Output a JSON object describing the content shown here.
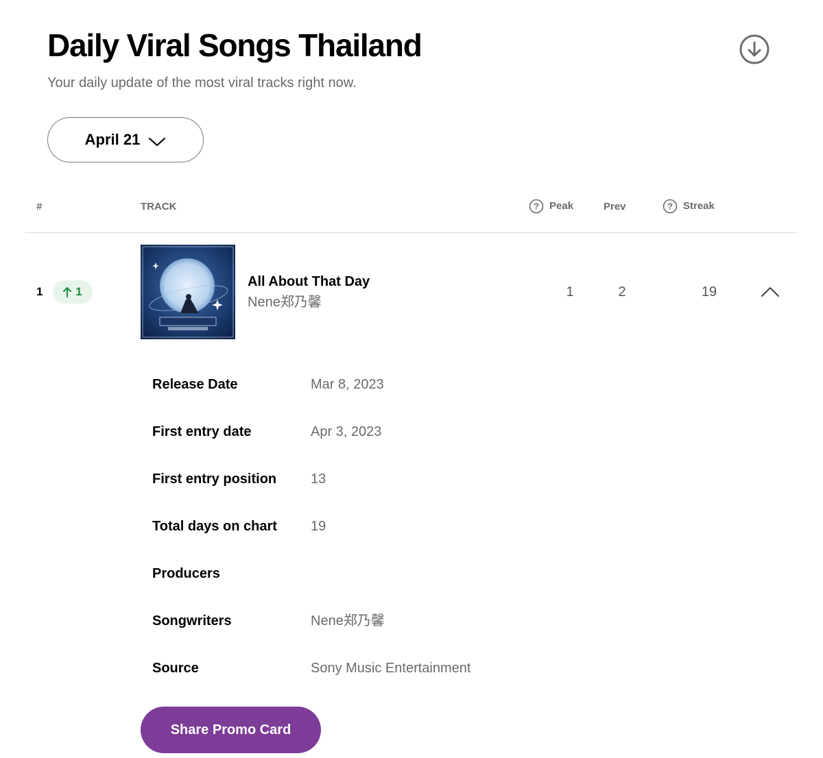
{
  "header": {
    "title": "Daily Viral Songs Thailand",
    "subtitle": "Your daily update of the most viral tracks right now.",
    "download_icon": "arrow-down-circle-icon"
  },
  "date_selector": {
    "label": "April 21",
    "icon": "chevron-down-icon"
  },
  "table": {
    "columns": {
      "rank": "#",
      "track": "TRACK",
      "peak": "Peak",
      "prev": "Prev",
      "streak": "Streak"
    },
    "help_icon": "question-circle-icon"
  },
  "row": {
    "rank": "1",
    "movement": {
      "direction": "up",
      "value": "1",
      "color": "#1e8b3a"
    },
    "title": "All About That Day",
    "artist": "Nene郑乃馨",
    "peak": "1",
    "prev": "2",
    "streak": "19",
    "collapse_icon": "chevron-up-icon"
  },
  "details": {
    "release_date": {
      "label": "Release Date",
      "value": "Mar 8, 2023"
    },
    "first_entry_date": {
      "label": "First entry date",
      "value": "Apr 3, 2023"
    },
    "first_entry_position": {
      "label": "First entry position",
      "value": "13"
    },
    "total_days": {
      "label": "Total days on chart",
      "value": "19"
    },
    "producers": {
      "label": "Producers",
      "value": ""
    },
    "songwriters": {
      "label": "Songwriters",
      "value": "Nene郑乃馨"
    },
    "source": {
      "label": "Source",
      "value": "Sony Music Entertainment"
    }
  },
  "promo_button": {
    "label": "Share Promo Card",
    "color": "#7d3c98"
  }
}
